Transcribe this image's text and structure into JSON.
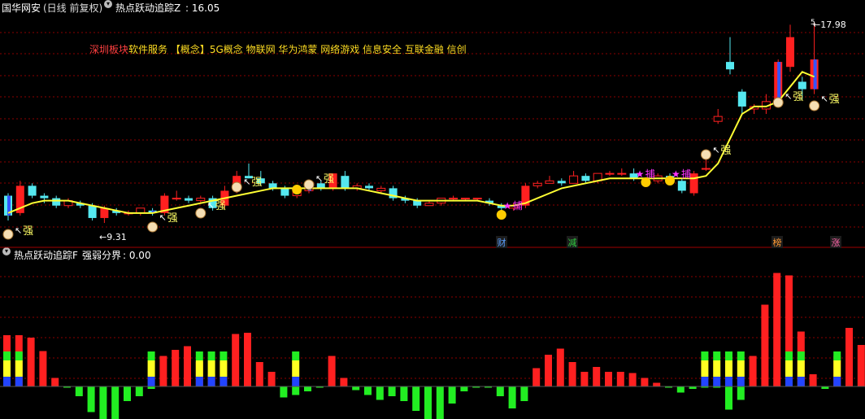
{
  "header": {
    "stock_name": "国华网安",
    "period": "(日线 前复权)",
    "indicator": "热点跃动追踪Z",
    "value_text": ": 16.05"
  },
  "concepts": {
    "highlight": "深圳板块",
    "items": "软件服务 【概念】5G概念 物联网 华为鸿蒙 网络游戏 信息安全 互联金融 信创"
  },
  "sub_header": {
    "indicator": "热点跃动追踪F",
    "label": "强弱分界",
    "value_text": ": 0.00"
  },
  "annotations": {
    "low_price": "9.31",
    "high_price": "17.98",
    "strong": "强",
    "catch": "捕",
    "top_marker": "5"
  },
  "event_badges": [
    {
      "text": "财",
      "color": "#5aa0ff"
    },
    {
      "text": "减",
      "color": "#2ecc40"
    },
    {
      "text": "榜",
      "color": "#ff9933"
    },
    {
      "text": "涨",
      "color": "#ff66aa"
    }
  ],
  "colors": {
    "up": "#ff2020",
    "down": "#55e8f0",
    "ma": "#ffff33",
    "grid": "#8b0000",
    "bar_green": "#22ee22",
    "bar_yellow": "#ffff22",
    "bar_blue": "#2244ff"
  },
  "chart_data": [
    {
      "type": "candlestick",
      "y_range": [
        9.31,
        17.98
      ],
      "x_count": 68,
      "candles": [
        [
          11.0,
          10.2,
          11.1,
          10.0
        ],
        [
          10.3,
          11.4,
          11.6,
          10.2
        ],
        [
          11.4,
          11.0,
          11.5,
          10.9
        ],
        [
          11.0,
          10.9,
          11.1,
          10.7
        ],
        [
          10.9,
          10.6,
          11.0,
          10.5
        ],
        [
          10.6,
          10.8,
          10.9,
          10.5
        ],
        [
          10.7,
          10.6,
          10.8,
          10.5
        ],
        [
          10.6,
          10.1,
          10.7,
          10.0
        ],
        [
          10.1,
          10.5,
          10.6,
          9.9
        ],
        [
          10.4,
          10.3,
          10.5,
          10.2
        ],
        [
          10.3,
          10.3,
          10.4,
          10.2
        ],
        [
          10.3,
          10.5,
          10.5,
          10.2
        ],
        [
          10.4,
          10.3,
          10.5,
          10.2
        ],
        [
          10.3,
          11.0,
          11.1,
          10.2
        ],
        [
          10.9,
          10.9,
          11.2,
          10.8
        ],
        [
          10.9,
          10.8,
          11.0,
          10.7
        ],
        [
          10.8,
          10.9,
          11.0,
          10.7
        ],
        [
          10.9,
          10.5,
          11.0,
          10.4
        ],
        [
          10.6,
          11.2,
          11.4,
          10.5
        ],
        [
          11.2,
          11.8,
          12.0,
          11.1
        ],
        [
          11.8,
          11.7,
          12.3,
          11.7
        ],
        [
          11.7,
          11.5,
          12.0,
          11.4
        ],
        [
          11.5,
          11.3,
          11.6,
          11.2
        ],
        [
          11.3,
          11.0,
          11.4,
          10.9
        ],
        [
          11.0,
          11.3,
          11.4,
          10.9
        ],
        [
          11.2,
          11.5,
          11.6,
          11.1
        ],
        [
          11.5,
          11.3,
          11.6,
          11.2
        ],
        [
          11.3,
          11.9,
          11.9,
          11.2
        ],
        [
          11.8,
          11.3,
          12.0,
          11.2
        ],
        [
          11.3,
          11.4,
          11.5,
          11.2
        ],
        [
          11.4,
          11.3,
          11.5,
          11.2
        ],
        [
          11.2,
          11.3,
          11.4,
          11.1
        ],
        [
          11.3,
          10.9,
          11.4,
          10.8
        ],
        [
          10.9,
          10.8,
          11.0,
          10.7
        ],
        [
          10.8,
          10.6,
          10.9,
          10.5
        ],
        [
          10.6,
          10.7,
          10.8,
          10.6
        ],
        [
          10.7,
          10.9,
          10.9,
          10.6
        ],
        [
          10.9,
          10.9,
          11.0,
          10.8
        ],
        [
          10.9,
          10.9,
          10.9,
          10.8
        ],
        [
          10.9,
          10.9,
          10.9,
          10.8
        ],
        [
          10.8,
          10.7,
          10.9,
          10.6
        ],
        [
          10.6,
          10.5,
          10.7,
          10.4
        ],
        [
          10.5,
          10.6,
          10.7,
          10.4
        ],
        [
          10.6,
          11.4,
          11.5,
          10.5
        ],
        [
          11.4,
          11.5,
          11.6,
          11.3
        ],
        [
          11.5,
          11.6,
          11.8,
          11.5
        ],
        [
          11.6,
          11.5,
          11.7,
          11.4
        ],
        [
          11.5,
          11.8,
          12.0,
          11.5
        ],
        [
          11.8,
          11.6,
          11.9,
          11.5
        ],
        [
          11.6,
          11.9,
          11.9,
          11.5
        ],
        [
          11.9,
          11.9,
          12.0,
          11.8
        ],
        [
          11.9,
          11.9,
          12.1,
          11.8
        ],
        [
          11.9,
          11.7,
          12.1,
          11.6
        ],
        [
          11.6,
          11.5,
          11.7,
          11.4
        ],
        [
          11.6,
          11.8,
          11.9,
          11.5
        ],
        [
          11.8,
          11.6,
          11.9,
          11.5
        ],
        [
          11.6,
          11.2,
          11.7,
          11.1
        ],
        [
          11.1,
          11.9,
          12.0,
          11.0
        ],
        [
          12.1,
          12.1,
          12.5,
          12.0
        ],
        [
          14.0,
          14.2,
          14.5,
          13.9
        ],
        [
          16.4,
          16.1,
          17.4,
          15.9
        ],
        [
          15.2,
          14.6,
          15.3,
          14.3
        ],
        [
          14.5,
          14.6,
          14.7,
          14.3
        ],
        [
          14.5,
          14.8,
          15.1,
          14.3
        ],
        [
          14.9,
          16.4,
          16.5,
          14.8
        ],
        [
          16.2,
          17.4,
          17.9,
          16.0
        ],
        [
          15.6,
          15.3,
          15.8,
          14.9
        ],
        [
          15.3,
          16.5,
          17.98,
          15.1
        ]
      ],
      "ma": [
        10.3,
        10.5,
        10.7,
        10.8,
        10.8,
        10.8,
        10.7,
        10.6,
        10.5,
        10.4,
        10.3,
        10.3,
        10.3,
        10.4,
        10.5,
        10.6,
        10.7,
        10.8,
        10.9,
        11.0,
        11.1,
        11.2,
        11.3,
        11.3,
        11.3,
        11.3,
        11.3,
        11.3,
        11.3,
        11.3,
        11.2,
        11.1,
        11.0,
        10.9,
        10.8,
        10.8,
        10.8,
        10.8,
        10.8,
        10.8,
        10.7,
        10.6,
        10.6,
        10.7,
        10.9,
        11.1,
        11.3,
        11.4,
        11.5,
        11.6,
        11.7,
        11.7,
        11.7,
        11.7,
        11.7,
        11.7,
        11.7,
        11.7,
        11.8,
        12.3,
        13.3,
        14.3,
        14.6,
        14.6,
        14.8,
        15.4,
        16.0,
        15.8
      ]
    },
    {
      "type": "bar",
      "y_range": [
        -3,
        10
      ],
      "values": [
        4.2,
        4.2,
        4.0,
        2.9,
        0.7,
        -0.1,
        -0.8,
        -2.1,
        -3.0,
        -3.2,
        -1.2,
        -0.8,
        -0.2,
        2.5,
        3.0,
        3.3,
        2.0,
        1.0,
        2.0,
        4.3,
        4.4,
        2.0,
        1.2,
        -0.9,
        -0.7,
        -0.4,
        -0.1,
        2.5,
        0.7,
        -0.3,
        -0.7,
        -1.1,
        -0.8,
        -1.2,
        -2.0,
        -2.8,
        -4.1,
        -1.4,
        -0.4,
        -0.1,
        -0.1,
        -0.8,
        -1.8,
        -1.2,
        1.5,
        2.6,
        3.1,
        2.0,
        1.2,
        1.6,
        1.2,
        1.2,
        1.1,
        0.7,
        0.3,
        -0.1,
        -0.5,
        -0.2,
        -0.1,
        -0.1,
        -1.9,
        -1.1,
        2.5,
        6.7,
        9.3,
        9.1,
        4.5,
        1.0,
        -0.2,
        2.5,
        4.8,
        3.4,
        -0.1,
        2.5
      ]
    }
  ]
}
